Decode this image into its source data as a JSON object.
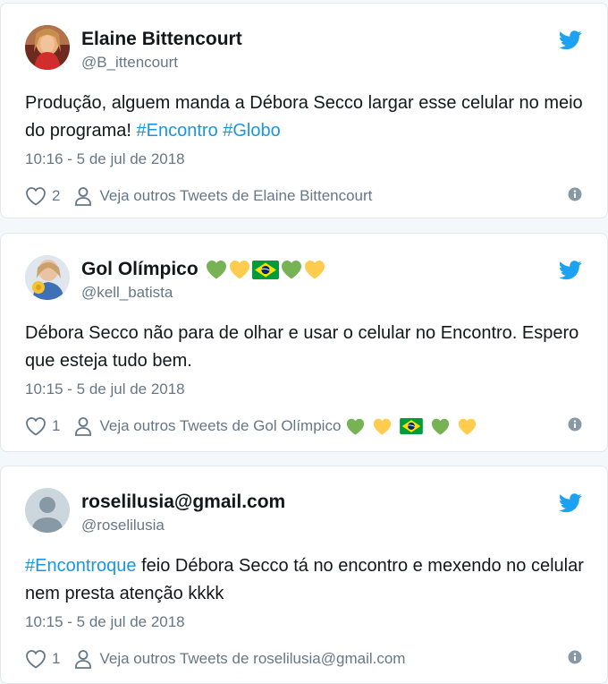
{
  "tweets": [
    {
      "name": "Elaine Bittencourt",
      "name_emojis": [],
      "handle": "@B_ittencourt",
      "text": [
        {
          "t": "Produção, alguem manda a Débora Secco largar esse celular no meio do programa! ",
          "tag": false
        },
        {
          "t": "#Encontro",
          "tag": true
        },
        {
          "t": " ",
          "tag": false
        },
        {
          "t": "#Globo",
          "tag": true
        }
      ],
      "time": "10:16 - 5 de jul de 2018",
      "likes": "2",
      "see_others": "Veja outros Tweets de Elaine Bittencourt",
      "avatar": "elaine"
    },
    {
      "name": "Gol Olímpico",
      "name_emojis": [
        "green-heart",
        "yellow-heart",
        "brazil-flag",
        "green-heart",
        "yellow-heart"
      ],
      "handle": "@kell_batista",
      "text": [
        {
          "t": "Débora Secco não para de olhar e usar o celular no Encontro. Espero que esteja tudo bem.",
          "tag": false
        }
      ],
      "time": "10:15 - 5 de jul de 2018",
      "likes": "1",
      "see_others": "Veja outros Tweets de Gol Olímpico",
      "avatar": "gol"
    },
    {
      "name": "roselilusia@gmail.com",
      "name_emojis": [],
      "handle": "@roselilusia",
      "text": [
        {
          "t": "#Encontroque",
          "tag": true
        },
        {
          "t": " feio Débora Secco tá no encontro e mexendo no celular nem presta atenção kkkk",
          "tag": false
        }
      ],
      "time": "10:15 - 5 de jul de 2018",
      "likes": "1",
      "see_others": "Veja outros Tweets de roselilusia@gmail.com",
      "avatar": "default"
    }
  ],
  "colors": {
    "twitter_blue": "#1da1f2",
    "hashtag": "#1b95e0",
    "secondary_text": "#657786",
    "green_heart": "#77b255",
    "yellow_heart": "#ffcc4d"
  },
  "icons": {
    "bird": "twitter-bird-icon",
    "like": "heart-outline-icon",
    "person": "person-outline-icon",
    "info": "info-circle-icon"
  }
}
